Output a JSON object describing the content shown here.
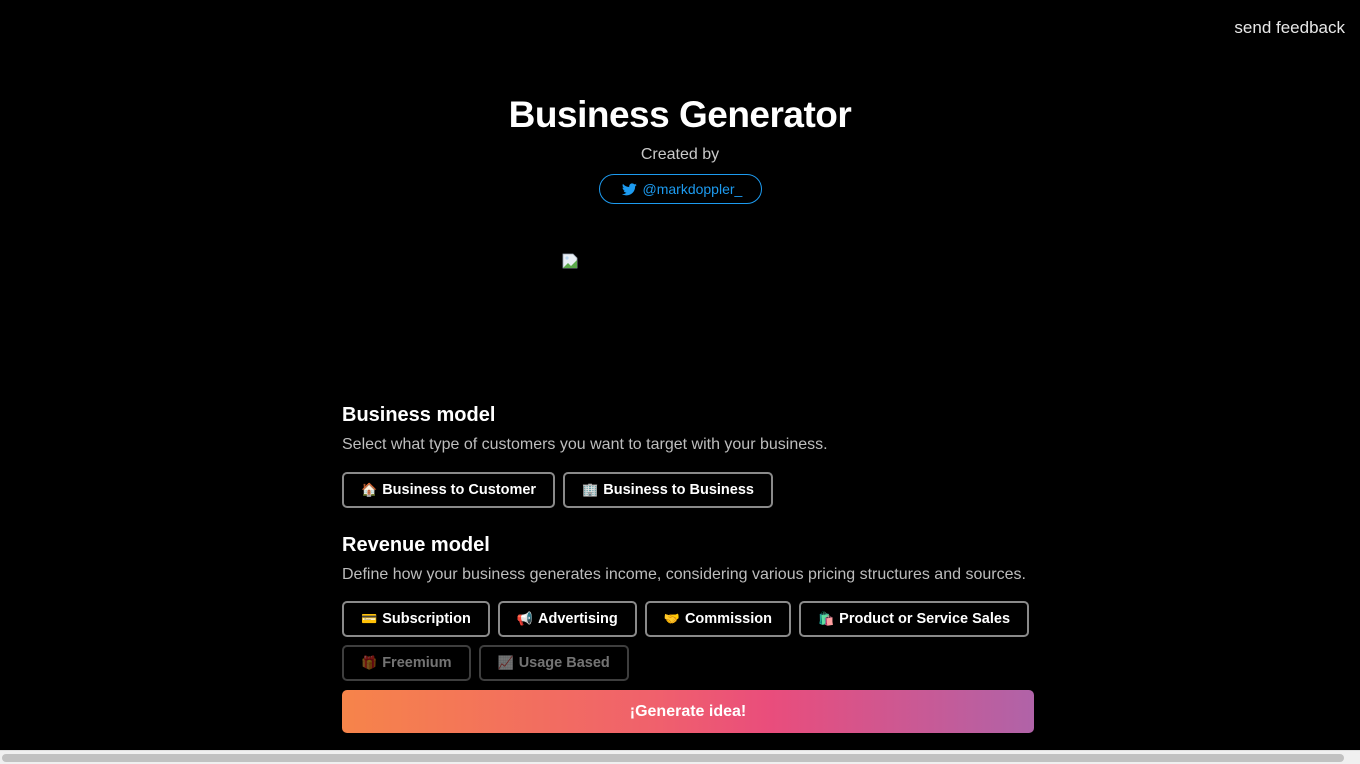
{
  "header": {
    "feedback_link": "send feedback",
    "title": "Business Generator",
    "created_by": "Created by",
    "twitter_handle": "@markdoppler_",
    "twitter_color": "#1d9bf0"
  },
  "business_model": {
    "title": "Business model",
    "description": "Select what type of customers you want to target with your business.",
    "options": [
      {
        "emoji": "🏠",
        "label": "Business to Customer"
      },
      {
        "emoji": "🏢",
        "label": "Business to Business"
      }
    ]
  },
  "revenue_model": {
    "title": "Revenue model",
    "description": "Define how your business generates income, considering various pricing structures and sources.",
    "options": [
      {
        "emoji": "💳",
        "label": "Subscription"
      },
      {
        "emoji": "📢",
        "label": "Advertising"
      },
      {
        "emoji": "🤝",
        "label": "Commission"
      },
      {
        "emoji": "🛍️",
        "label": "Product or Service Sales"
      },
      {
        "emoji": "🎁",
        "label": "Freemium"
      },
      {
        "emoji": "📈",
        "label": "Usage Based"
      }
    ]
  },
  "generate_button": {
    "label": "¡Generate idea!",
    "gradient": [
      "#f6844a",
      "#f0616c",
      "#e94d7c",
      "#b063a8"
    ]
  }
}
